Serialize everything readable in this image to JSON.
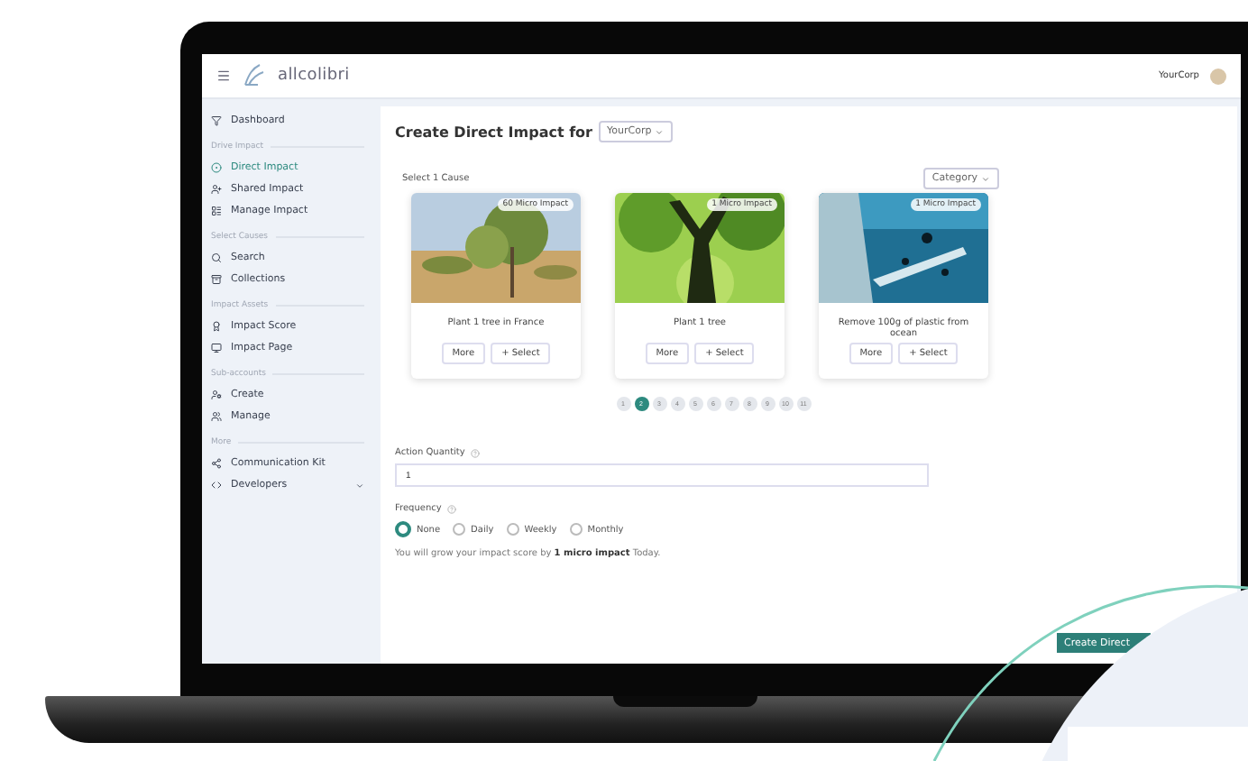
{
  "header": {
    "logo": "allcolibri",
    "account": "YourCorp"
  },
  "sidebar": {
    "top": [
      {
        "label": "Dashboard",
        "selected": false
      }
    ],
    "sections": [
      {
        "title": "Drive Impact",
        "items": [
          {
            "label": "Direct Impact",
            "selected": true
          },
          {
            "label": "Shared Impact",
            "selected": false
          },
          {
            "label": "Manage Impact",
            "selected": false
          }
        ]
      },
      {
        "title": "Select Causes",
        "items": [
          {
            "label": "Search",
            "selected": false
          },
          {
            "label": "Collections",
            "selected": false
          }
        ]
      },
      {
        "title": "Impact Assets",
        "items": [
          {
            "label": "Impact Score",
            "selected": false
          },
          {
            "label": "Impact Page",
            "selected": false
          }
        ]
      },
      {
        "title": "Sub-accounts",
        "items": [
          {
            "label": "Create",
            "selected": false
          },
          {
            "label": "Manage",
            "selected": false
          }
        ]
      },
      {
        "title": "More",
        "items": [
          {
            "label": "Communication Kit",
            "selected": false
          },
          {
            "label": "Developers",
            "selected": false
          }
        ]
      }
    ]
  },
  "main": {
    "title": "Create Direct Impact for",
    "account_select": "YourCorp",
    "select_label": "Select 1 Cause",
    "category_select": "Category",
    "causes": [
      {
        "badge": "60 Micro Impact",
        "title": "Plant 1 tree in France",
        "more": "More",
        "select": "+ Select"
      },
      {
        "badge": "1 Micro Impact",
        "title": "Plant 1 tree",
        "more": "More",
        "select": "+ Select"
      },
      {
        "badge": "1 Micro Impact",
        "title": "Remove 100g of plastic from ocean",
        "more": "More",
        "select": "+ Select"
      }
    ],
    "pages": [
      {
        "label": "1",
        "selected": false
      },
      {
        "label": "2",
        "selected": true
      },
      {
        "label": "3",
        "selected": false
      },
      {
        "label": "4",
        "selected": false
      },
      {
        "label": "5",
        "selected": false
      },
      {
        "label": "6",
        "selected": false
      },
      {
        "label": "7",
        "selected": false
      },
      {
        "label": "8",
        "selected": false
      },
      {
        "label": "9",
        "selected": false
      },
      {
        "label": "10",
        "selected": false
      },
      {
        "label": "11",
        "selected": false
      }
    ],
    "quantity": {
      "label": "Action Quantity",
      "value": "1"
    },
    "frequency": {
      "label": "Frequency",
      "options": [
        {
          "label": "None",
          "selected": true
        },
        {
          "label": "Daily",
          "selected": false
        },
        {
          "label": "Weekly",
          "selected": false
        },
        {
          "label": "Monthly",
          "selected": false
        }
      ]
    },
    "summary": "You will grow your impact score by **1 micro impact** Today.",
    "submit": "Create Direct"
  }
}
